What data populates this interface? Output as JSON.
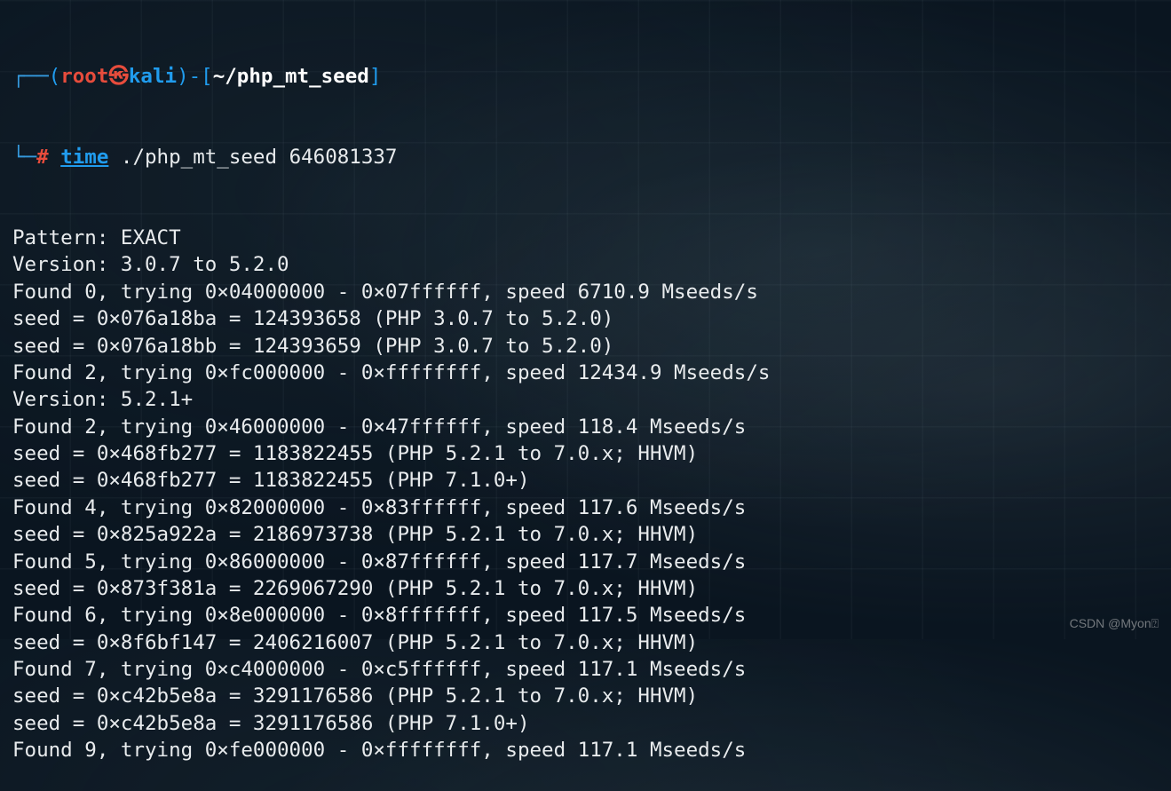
{
  "prompt": {
    "box_top": "┌──",
    "box_bottom": "└─",
    "paren_open": "(",
    "root": "root",
    "kali_icon": "㉿",
    "kali": "kali",
    "paren_close": ")",
    "dash": "-",
    "bracket_open": "[",
    "path": "~/php_mt_seed",
    "bracket_close": "]",
    "hash": "#",
    "time": "time",
    "command": " ./php_mt_seed 646081337"
  },
  "output": [
    "Pattern: EXACT",
    "Version: 3.0.7 to 5.2.0",
    "Found 0, trying 0×04000000 - 0×07ffffff, speed 6710.9 Mseeds/s",
    "seed = 0×076a18ba = 124393658 (PHP 3.0.7 to 5.2.0)",
    "seed = 0×076a18bb = 124393659 (PHP 3.0.7 to 5.2.0)",
    "Found 2, trying 0×fc000000 - 0×ffffffff, speed 12434.9 Mseeds/s",
    "Version: 5.2.1+",
    "Found 2, trying 0×46000000 - 0×47ffffff, speed 118.4 Mseeds/s",
    "seed = 0×468fb277 = 1183822455 (PHP 5.2.1 to 7.0.x; HHVM)",
    "seed = 0×468fb277 = 1183822455 (PHP 7.1.0+)",
    "Found 4, trying 0×82000000 - 0×83ffffff, speed 117.6 Mseeds/s",
    "seed = 0×825a922a = 2186973738 (PHP 5.2.1 to 7.0.x; HHVM)",
    "Found 5, trying 0×86000000 - 0×87ffffff, speed 117.7 Mseeds/s",
    "seed = 0×873f381a = 2269067290 (PHP 5.2.1 to 7.0.x; HHVM)",
    "Found 6, trying 0×8e000000 - 0×8fffffff, speed 117.5 Mseeds/s",
    "seed = 0×8f6bf147 = 2406216007 (PHP 5.2.1 to 7.0.x; HHVM)",
    "Found 7, trying 0×c4000000 - 0×c5ffffff, speed 117.1 Mseeds/s",
    "seed = 0×c42b5e8a = 3291176586 (PHP 5.2.1 to 7.0.x; HHVM)",
    "seed = 0×c42b5e8a = 3291176586 (PHP 7.1.0+)",
    "Found 9, trying 0×fe000000 - 0×ffffffff, speed 117.1 Mseeds/s"
  ],
  "watermark": "CSDN @Myon⍰"
}
